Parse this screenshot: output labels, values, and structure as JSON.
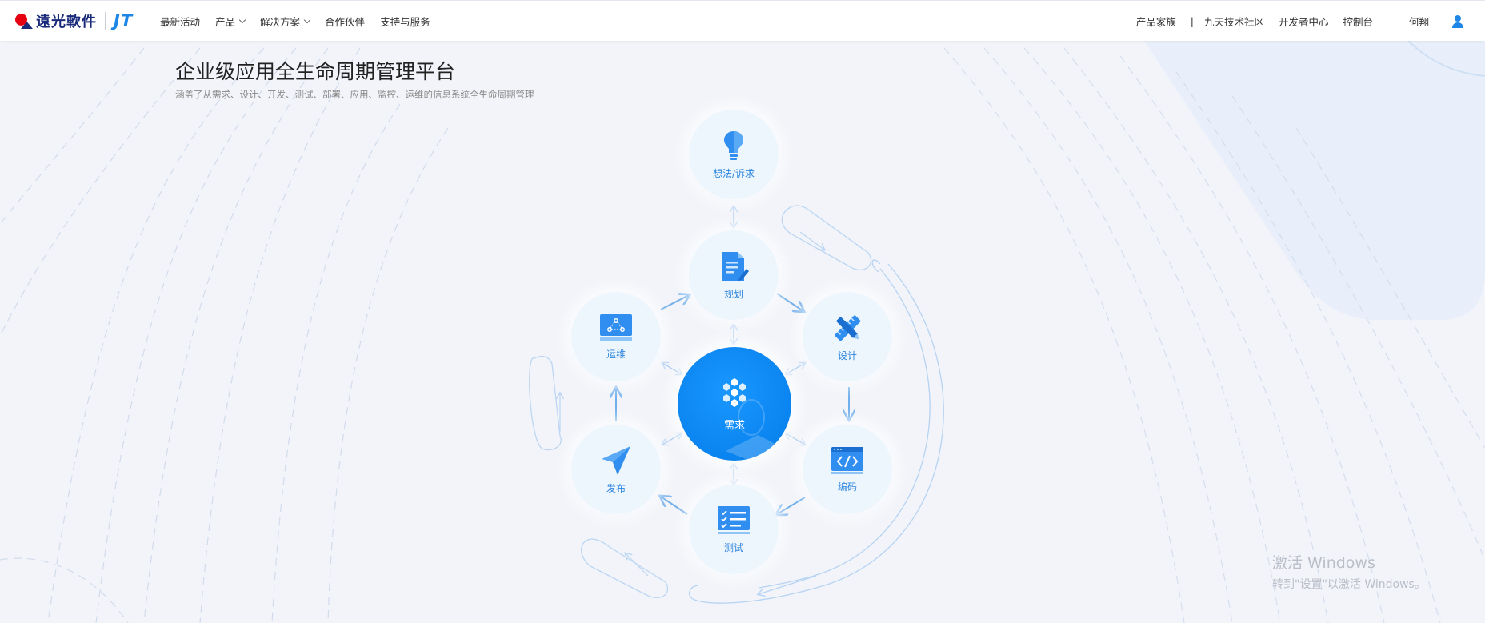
{
  "header": {
    "brand_cn": "遠光軟件",
    "brand_jt": "JT",
    "nav": [
      {
        "label": "最新活动",
        "dropdown": false
      },
      {
        "label": "产品",
        "dropdown": true
      },
      {
        "label": "解决方案",
        "dropdown": true
      },
      {
        "label": "合作伙伴",
        "dropdown": false
      },
      {
        "label": "支持与服务",
        "dropdown": false
      }
    ],
    "right_nav": [
      "产品家族",
      "九天技术社区",
      "开发者中心",
      "控制台"
    ],
    "divider": "|",
    "user_name": "何翔"
  },
  "hero": {
    "title": "企业级应用全生命周期管理平台",
    "subtitle": "涵盖了从需求、设计、开发、测试、部署、应用、监控、运维的信息系统全生命周期管理"
  },
  "diagram": {
    "center": {
      "label": "需求",
      "icon": "hexagon-cluster-icon"
    },
    "nodes": {
      "idea": {
        "label": "想法/诉求",
        "icon": "lightbulb-icon"
      },
      "plan": {
        "label": "规划",
        "icon": "document-edit-icon"
      },
      "design": {
        "label": "设计",
        "icon": "ruler-pencil-icon"
      },
      "code": {
        "label": "编码",
        "icon": "code-window-icon"
      },
      "test": {
        "label": "测试",
        "icon": "checklist-icon"
      },
      "release": {
        "label": "发布",
        "icon": "paper-plane-icon"
      },
      "ops": {
        "label": "运维",
        "icon": "monitor-network-icon"
      }
    }
  },
  "watermark": {
    "title": "激活 Windows",
    "subtitle": "转到\"设置\"以激活 Windows。"
  },
  "colors": {
    "accent": "#1e86e6",
    "center_fill": "#0a84f0",
    "node_fill": "#eef6fd",
    "brand_red": "#e60012",
    "brand_navy": "#1a2a7a"
  }
}
